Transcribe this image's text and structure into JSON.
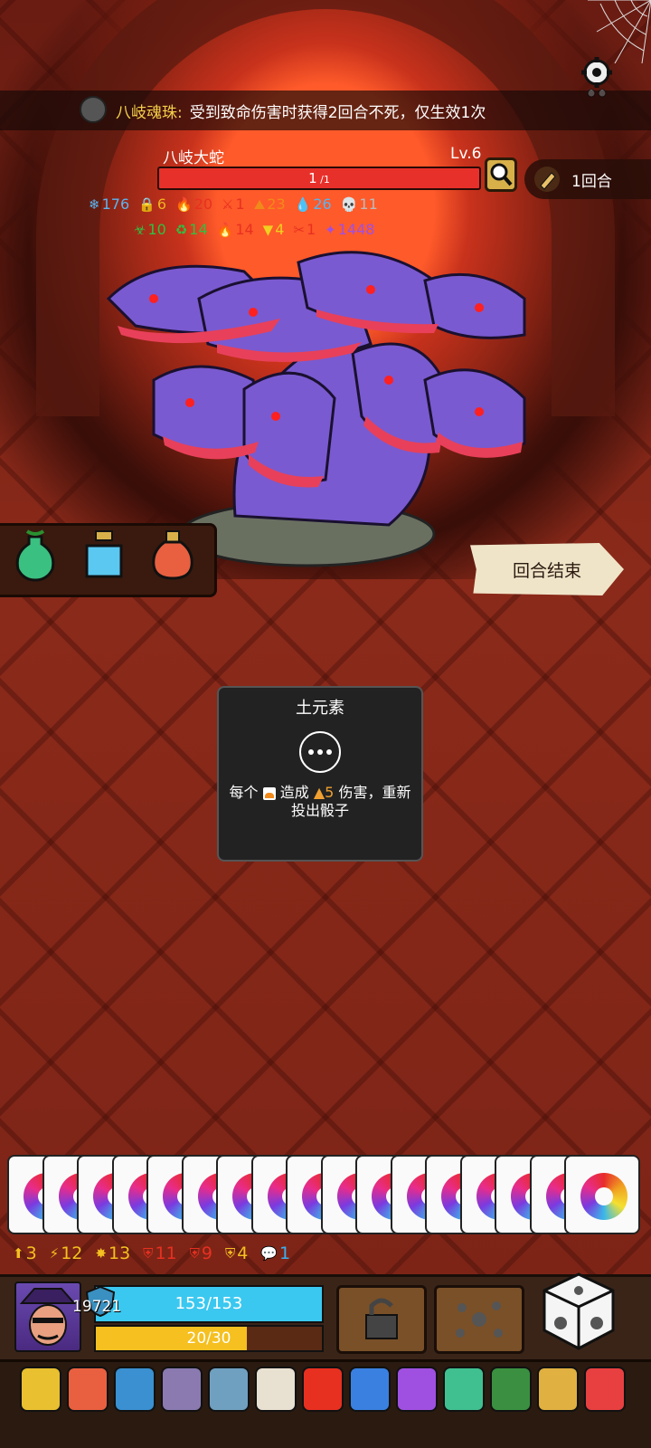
{
  "boss_relic": {
    "name": "八岐魂珠:",
    "description": "受到致命伤害时获得2回合不死，仅生效1次"
  },
  "boss": {
    "name": "八岐大蛇",
    "level": "Lv.6",
    "hp_current": "1",
    "hp_max": "1",
    "hp_fraction": 1.0
  },
  "round": {
    "label": "1回合"
  },
  "boss_stats_row1": [
    {
      "icon": "snowflake-icon",
      "glyph": "❄",
      "value": "176",
      "color": "#5ab4f0"
    },
    {
      "icon": "lock-icon",
      "glyph": "🔒",
      "value": "6",
      "color": "#f0b020"
    },
    {
      "icon": "fire-claw-icon",
      "glyph": "🔥",
      "value": "20",
      "color": "#e83020"
    },
    {
      "icon": "sword-icon",
      "glyph": "⚔",
      "value": "1",
      "color": "#e83020"
    },
    {
      "icon": "earth-icon",
      "glyph": "⛰",
      "value": "23",
      "color": "#f08a1a"
    },
    {
      "icon": "water-icon",
      "glyph": "💧",
      "value": "26",
      "color": "#5ab4f0"
    },
    {
      "icon": "skull-icon",
      "glyph": "💀",
      "value": "11",
      "color": "#bbbbbb"
    }
  ],
  "boss_stats_row2": [
    {
      "icon": "poison-icon",
      "glyph": "☣",
      "value": "10",
      "color": "#30c040"
    },
    {
      "icon": "regen-icon",
      "glyph": "♻",
      "value": "14",
      "color": "#30c040"
    },
    {
      "icon": "burn-icon",
      "glyph": "🔥",
      "value": "14",
      "color": "#e83020"
    },
    {
      "icon": "triangle-icon",
      "glyph": "▼",
      "value": "4",
      "color": "#f0d020"
    },
    {
      "icon": "bleed-icon",
      "glyph": "✂",
      "value": "1",
      "color": "#e83020"
    },
    {
      "icon": "rune-icon",
      "glyph": "✦",
      "value": "1448",
      "color": "#a050e0"
    }
  ],
  "end_turn": {
    "label": "回合结束"
  },
  "tooltip": {
    "title": "土元素",
    "desc_prefix": "每个",
    "desc_mid": "造成",
    "damage": "5",
    "desc_suffix": "伤害，重新投出骰子"
  },
  "hand": {
    "card_count": 17,
    "card_icon": "rainbow-swirl-icon"
  },
  "player_stats": [
    {
      "icon": "rank-icon",
      "glyph": "⬆",
      "value": "3",
      "color": "#f5c020"
    },
    {
      "icon": "lightning-icon",
      "glyph": "⚡",
      "value": "12",
      "color": "#f5c020"
    },
    {
      "icon": "star-bolt-icon",
      "glyph": "✸",
      "value": "13",
      "color": "#f5c020"
    },
    {
      "icon": "red-shield-icon",
      "glyph": "⛨",
      "value": "11",
      "color": "#e83020"
    },
    {
      "icon": "red-shield-check-icon",
      "glyph": "⛨",
      "value": "9",
      "color": "#e83020"
    },
    {
      "icon": "gold-shield-icon",
      "glyph": "⛨",
      "value": "4",
      "color": "#f5c020"
    },
    {
      "icon": "chat-icon",
      "glyph": "💬",
      "value": "1",
      "color": "#3ab0f0"
    }
  ],
  "player": {
    "shield": "19721",
    "hp_text": "153/153",
    "hp_fraction": 1.0,
    "energy_text": "20/30",
    "energy_fraction": 0.667
  },
  "colors": {
    "accent_hp": "#3ac8f0",
    "energy": "#f5c020",
    "boss_hp": "#e8302a",
    "relic_name": "#f5d04a"
  }
}
